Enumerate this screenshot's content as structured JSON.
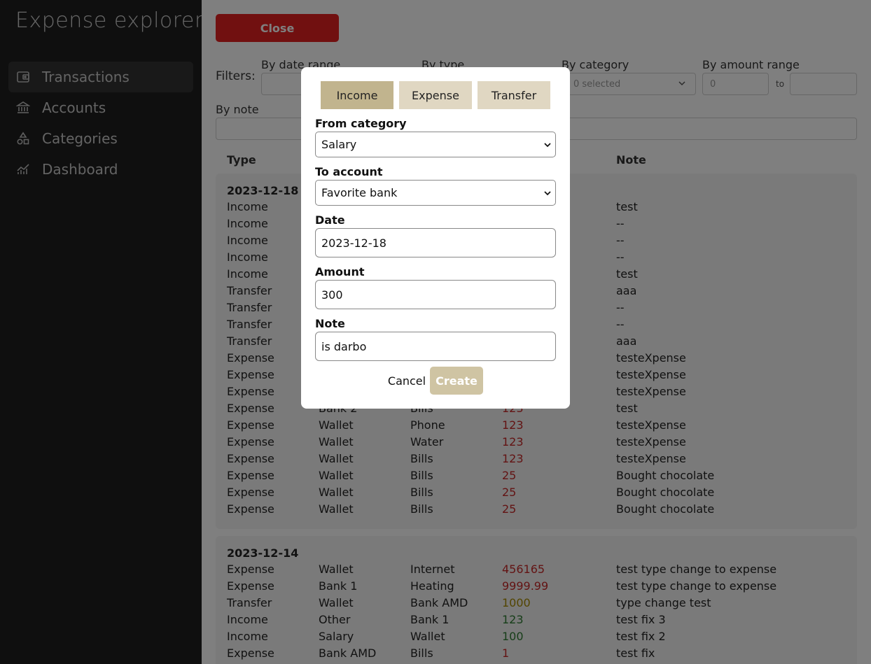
{
  "app": {
    "title": "Expense explorer"
  },
  "sidebar": {
    "items": [
      {
        "label": "Transactions",
        "icon": "wallet-icon",
        "active": true
      },
      {
        "label": "Accounts",
        "icon": "bank-icon",
        "active": false
      },
      {
        "label": "Categories",
        "icon": "shapes-icon",
        "active": false
      },
      {
        "label": "Dashboard",
        "icon": "chart-icon",
        "active": false
      }
    ]
  },
  "toolbar": {
    "close_label": "Close"
  },
  "filters": {
    "label": "Filters:",
    "date_range_label": "By date range",
    "type_label": "By type",
    "category_label": "By category",
    "category_value": "0 selected",
    "amount_range_label": "By amount range",
    "amount_from_value": "0",
    "amount_to_text": "to",
    "note_label": "By note"
  },
  "table": {
    "headers": {
      "type": "Type",
      "note": "Note"
    },
    "groups": [
      {
        "date": "2023-12-18",
        "rows": [
          {
            "type": "Income",
            "from": "",
            "to": "",
            "amount": "",
            "kind": "income",
            "note": "test"
          },
          {
            "type": "Income",
            "from": "",
            "to": "",
            "amount": "",
            "kind": "income",
            "note": "--"
          },
          {
            "type": "Income",
            "from": "",
            "to": "",
            "amount": "",
            "kind": "income",
            "note": "--"
          },
          {
            "type": "Income",
            "from": "",
            "to": "",
            "amount": "",
            "kind": "income",
            "note": "--"
          },
          {
            "type": "Income",
            "from": "",
            "to": "",
            "amount": "",
            "kind": "income",
            "note": "test"
          },
          {
            "type": "Transfer",
            "from": "",
            "to": "",
            "amount": "",
            "kind": "transfer",
            "note": "aaa"
          },
          {
            "type": "Transfer",
            "from": "",
            "to": "",
            "amount": "",
            "kind": "transfer",
            "note": "--"
          },
          {
            "type": "Transfer",
            "from": "",
            "to": "",
            "amount": "",
            "kind": "transfer",
            "note": "--"
          },
          {
            "type": "Transfer",
            "from": "",
            "to": "",
            "amount": "",
            "kind": "transfer",
            "note": "aaa"
          },
          {
            "type": "Expense",
            "from": "",
            "to": "",
            "amount": "",
            "kind": "expense",
            "note": "testeXpense"
          },
          {
            "type": "Expense",
            "from": "",
            "to": "",
            "amount": "",
            "kind": "expense",
            "note": "testeXpense"
          },
          {
            "type": "Expense",
            "from": "",
            "to": "",
            "amount": "",
            "kind": "expense",
            "note": "testeXpense"
          },
          {
            "type": "Expense",
            "from": "Bank 2",
            "to": "Bills",
            "amount": "123",
            "kind": "expense",
            "note": "test"
          },
          {
            "type": "Expense",
            "from": "Wallet",
            "to": "Phone",
            "amount": "123",
            "kind": "expense",
            "note": "testeXpense"
          },
          {
            "type": "Expense",
            "from": "Wallet",
            "to": "Water",
            "amount": "123",
            "kind": "expense",
            "note": "testeXpense"
          },
          {
            "type": "Expense",
            "from": "Wallet",
            "to": "Bills",
            "amount": "123",
            "kind": "expense",
            "note": "testeXpense"
          },
          {
            "type": "Expense",
            "from": "Wallet",
            "to": "Bills",
            "amount": "25",
            "kind": "expense",
            "note": "Bought chocolate"
          },
          {
            "type": "Expense",
            "from": "Wallet",
            "to": "Bills",
            "amount": "25",
            "kind": "expense",
            "note": "Bought chocolate"
          },
          {
            "type": "Expense",
            "from": "Wallet",
            "to": "Bills",
            "amount": "25",
            "kind": "expense",
            "note": "Bought chocolate"
          }
        ]
      },
      {
        "date": "2023-12-14",
        "rows": [
          {
            "type": "Expense",
            "from": "Wallet",
            "to": "Internet",
            "amount": "456165",
            "kind": "expense",
            "note": "test type change to expense"
          },
          {
            "type": "Expense",
            "from": "Bank 1",
            "to": "Heating",
            "amount": "9999.99",
            "kind": "expense",
            "note": "test type change to expense"
          },
          {
            "type": "Transfer",
            "from": "Wallet",
            "to": "Bank AMD",
            "amount": "1000",
            "kind": "transfer",
            "note": "type change test"
          },
          {
            "type": "Income",
            "from": "Other",
            "to": "Bank 1",
            "amount": "123",
            "kind": "income",
            "note": "test fix 3"
          },
          {
            "type": "Income",
            "from": "Salary",
            "to": "Wallet",
            "amount": "100",
            "kind": "income",
            "note": "test fix 2"
          },
          {
            "type": "Expense",
            "from": "Bank AMD",
            "to": "Bills",
            "amount": "1",
            "kind": "expense",
            "note": "test fix"
          }
        ]
      }
    ]
  },
  "colors": {
    "expense": "#c62828",
    "income": "#2e7d32",
    "transfer": "#a68a00",
    "accent_tab": "#c1b48e",
    "close_button": "#e32121"
  },
  "modal": {
    "tabs": [
      "Income",
      "Expense",
      "Transfer"
    ],
    "active_tab": "Income",
    "from_category_label": "From category",
    "from_category_value": "Salary",
    "to_account_label": "To account",
    "to_account_value": "Favorite bank",
    "date_label": "Date",
    "date_value": "2023-12-18",
    "amount_label": "Amount",
    "amount_value": "300",
    "note_label": "Note",
    "note_value": "is darbo",
    "cancel_label": "Cancel",
    "create_label": "Create"
  }
}
